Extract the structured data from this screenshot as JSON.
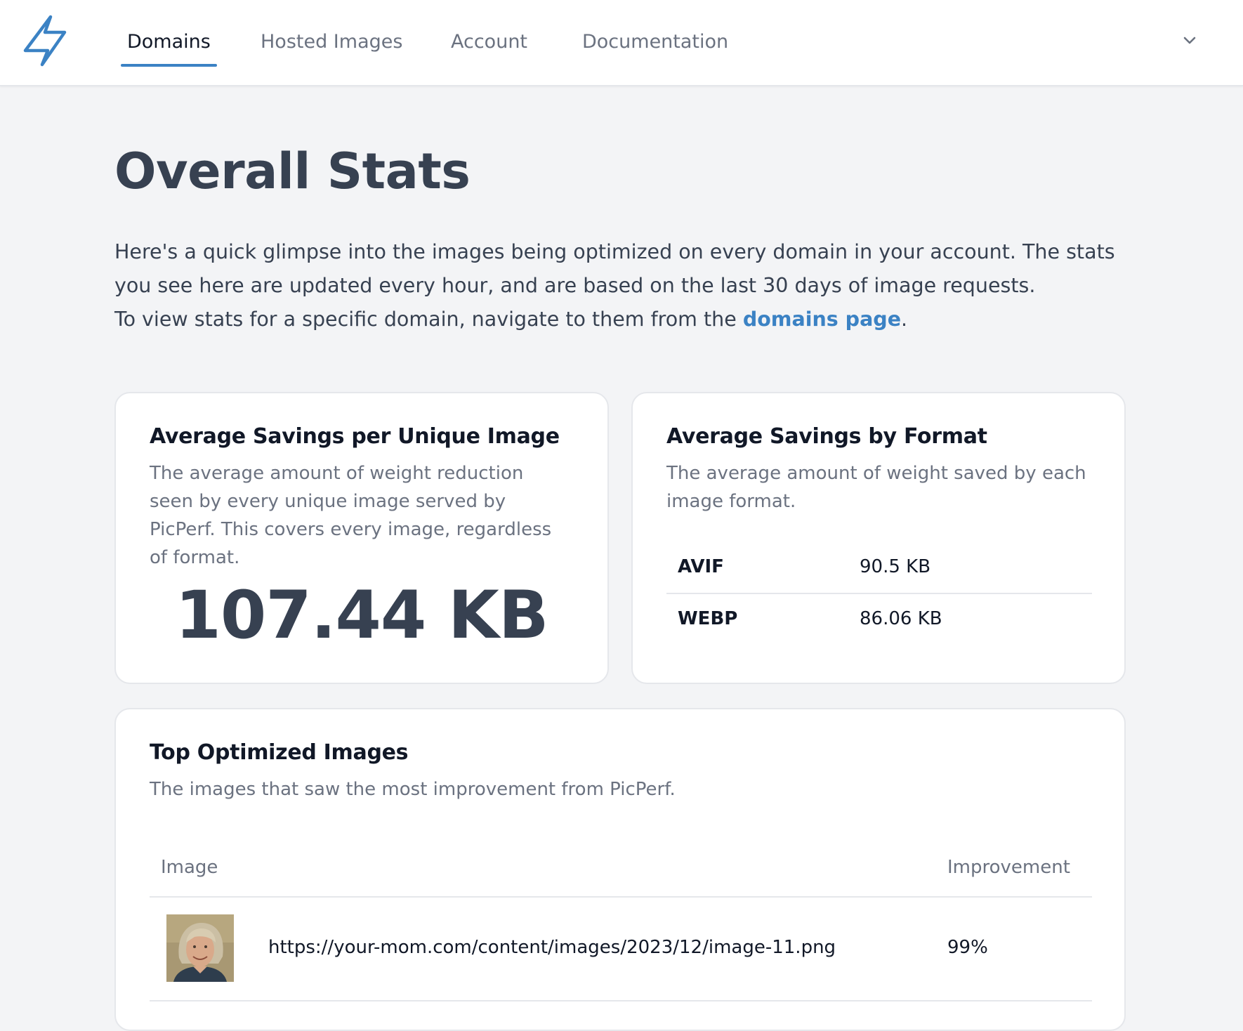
{
  "nav": {
    "logo_icon": "lightning-bolt-icon",
    "accent_color": "#3b82c4",
    "items": [
      {
        "label": "Domains",
        "active": true
      },
      {
        "label": "Hosted Images",
        "active": false
      },
      {
        "label": "Account",
        "active": false
      },
      {
        "label": "Documentation",
        "active": false
      }
    ],
    "user_menu_icon": "chevron-down-icon"
  },
  "page": {
    "title": "Overall Stats",
    "intro_line1": "Here's a quick glimpse into the images being optimized on every domain in your account. The stats you see here are updated every hour, and are based on the last 30 days of image requests.",
    "intro_line2_prefix": "To view stats for a specific domain, navigate to them from the ",
    "intro_link": "domains page",
    "intro_line2_suffix": "."
  },
  "savings_card": {
    "title": "Average Savings per Unique Image",
    "description": "The average amount of weight reduction seen by every unique image served by PicPerf. This covers every image, regardless of format.",
    "value": "107.44 KB"
  },
  "format_card": {
    "title": "Average Savings by Format",
    "description": "The average amount of weight saved by each image format.",
    "rows": [
      {
        "format": "AVIF",
        "value": "90.5 KB"
      },
      {
        "format": "WEBP",
        "value": "86.06 KB"
      }
    ]
  },
  "top_card": {
    "title": "Top Optimized Images",
    "description": "The images that saw the most improvement from PicPerf.",
    "columns": {
      "image": "Image",
      "improvement": "Improvement"
    },
    "rows": [
      {
        "url": "https://your-mom.com/content/images/2023/12/image-11.png",
        "improvement": "99%"
      }
    ]
  }
}
